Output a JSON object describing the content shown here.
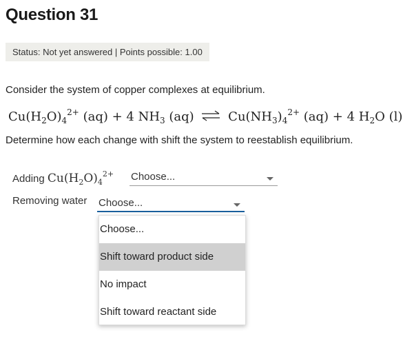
{
  "question": {
    "title": "Question 31",
    "status": "Status: Not yet answered | Points possible: 1.00"
  },
  "prompt": {
    "intro": "Consider the system of copper complexes at equilibrium.",
    "instruction": "Determine how each change with shift the system to reestablish equilibrium."
  },
  "equation": {
    "reactant1": "Cu(H",
    "r1_sub1": "2",
    "r1_mid": "O)",
    "r1_sub2": "4",
    "r1_sup": "2+",
    "r1_state": " (aq) + 4 NH",
    "r2_sub": "3",
    "r2_state": " (aq)",
    "product1": "Cu(NH",
    "p1_sub1": "3",
    "p1_mid": ")",
    "p1_sub2": "4",
    "p1_sup": "2+",
    "p1_state": " (aq) + 4 H",
    "p2_sub": "2",
    "p2_state": "O (l)"
  },
  "rows": [
    {
      "label_prefix": "Adding",
      "chem_a": "Cu(H",
      "chem_sub1": "2",
      "chem_b": "O)",
      "chem_sub2": "4",
      "chem_sup": "2+",
      "selected": "Choose..."
    },
    {
      "label": "Removing water",
      "selected": "Choose..."
    }
  ],
  "dropdown": {
    "options": [
      "Choose...",
      "Shift toward product side",
      "No impact",
      "Shift toward reactant side"
    ],
    "highlighted": "Shift toward product side"
  },
  "colors": {
    "status_bg": "#eeeeea",
    "focus_underline": "#1a5f9c",
    "highlight_bg": "#d0d0d0"
  }
}
